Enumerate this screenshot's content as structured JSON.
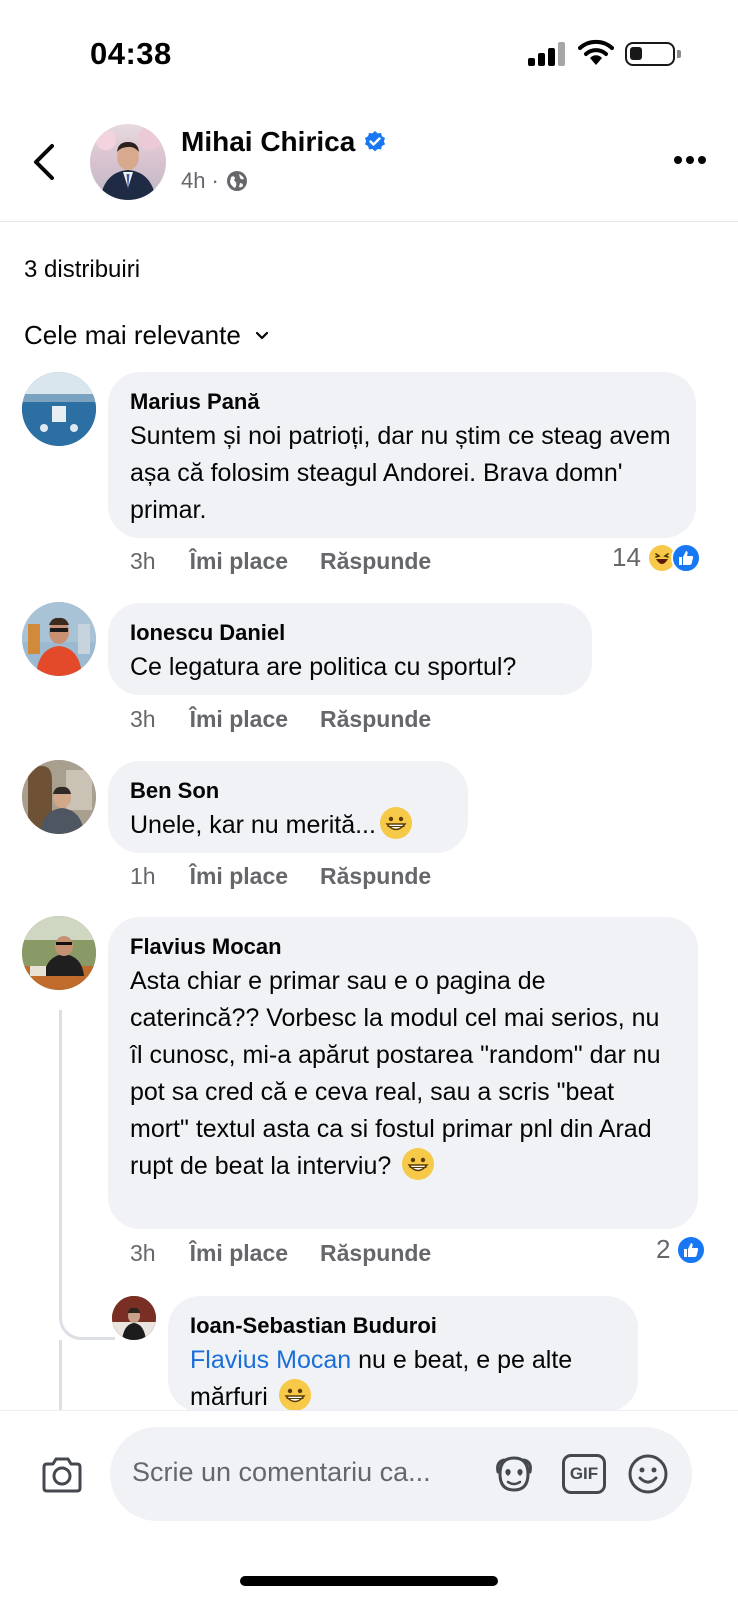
{
  "status_bar": {
    "time": "04:38"
  },
  "header": {
    "name": "Mihai Chirica",
    "time_ago": "4h",
    "separator": "·"
  },
  "shares": "3 distribuiri",
  "sort": {
    "label": "Cele mai relevante"
  },
  "comments": [
    {
      "author": "Marius Pană",
      "text": "Suntem și noi patrioți, dar nu știm ce steag avem așa că folosim steagul Andorei. Brava domn' primar.",
      "time": "3h",
      "like": "Îmi place",
      "reply": "Răspunde",
      "reaction_count": "14",
      "reactions": [
        "haha-icon",
        "like-icon"
      ]
    },
    {
      "author": "Ionescu Daniel",
      "text": "Ce legatura are politica cu sportul?",
      "time": "3h",
      "like": "Îmi place",
      "reply": "Răspunde"
    },
    {
      "author": "Ben Son",
      "text": "Unele, kar nu merită...",
      "emoji": "grinning-face-icon",
      "time": "1h",
      "like": "Îmi place",
      "reply": "Răspunde"
    },
    {
      "author": "Flavius Mocan",
      "text": "Asta chiar e primar sau e o pagina de caterincă?? Vorbesc la modul cel mai serios, nu îl cunosc, mi-a apărut postarea \"random\" dar nu pot sa cred că e ceva real, sau a scris \"beat mort\" textul asta ca si fostul primar pnl din Arad rupt de beat la interviu?",
      "emoji": "grinning-face-icon",
      "time": "3h",
      "like": "Îmi place",
      "reply": "Răspunde",
      "reaction_count": "2",
      "reactions": [
        "like-icon"
      ]
    }
  ],
  "reply": {
    "author": "Ioan-Sebastian Buduroi",
    "mention": "Flavius Mocan",
    "text": " nu e beat, e pe alte mărfuri",
    "emoji": "grinning-face-icon"
  },
  "composer": {
    "placeholder": "Scrie un comentariu ca...",
    "gif_label": "GIF"
  },
  "colors": {
    "accent": "#1877f2",
    "bubble": "#f0f2f5",
    "muted": "#65676b",
    "mention": "#1a6ed8"
  }
}
